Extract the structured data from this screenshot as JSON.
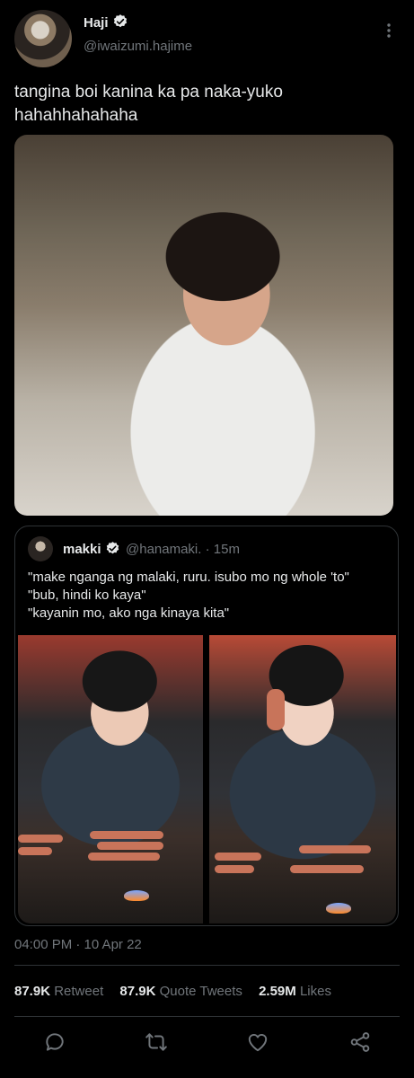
{
  "tweet": {
    "author_name": "Haji",
    "author_handle": "@iwaizumi.hajime",
    "text": "tangina boi kanina ka pa naka-yuko\nhahahhahahaha",
    "timestamp": "04:00 PM · 10 Apr 22"
  },
  "quote": {
    "author_name": "makki",
    "author_handle": "@hanamaki. · 15m",
    "lines": [
      "\"make nganga ng malaki, ruru. isubo mo ng whole 'to\"",
      "\"bub, hindi ko kaya\"",
      "\"kayanin mo, ako nga kinaya kita\""
    ]
  },
  "stats": {
    "retweets_count": "87.9K",
    "retweets_label": "Retweet",
    "quotes_count": "87.9K",
    "quotes_label": "Quote Tweets",
    "likes_count": "2.59M",
    "likes_label": "Likes"
  },
  "icons": {
    "verified": "verified-badge-icon",
    "more": "more-vertical-icon",
    "reply": "reply-icon",
    "retweet": "retweet-icon",
    "like": "like-icon",
    "share": "share-icon"
  },
  "colors": {
    "background": "#000000",
    "text": "#e7e9ea",
    "secondary": "#71767b",
    "border": "#2f3336"
  }
}
